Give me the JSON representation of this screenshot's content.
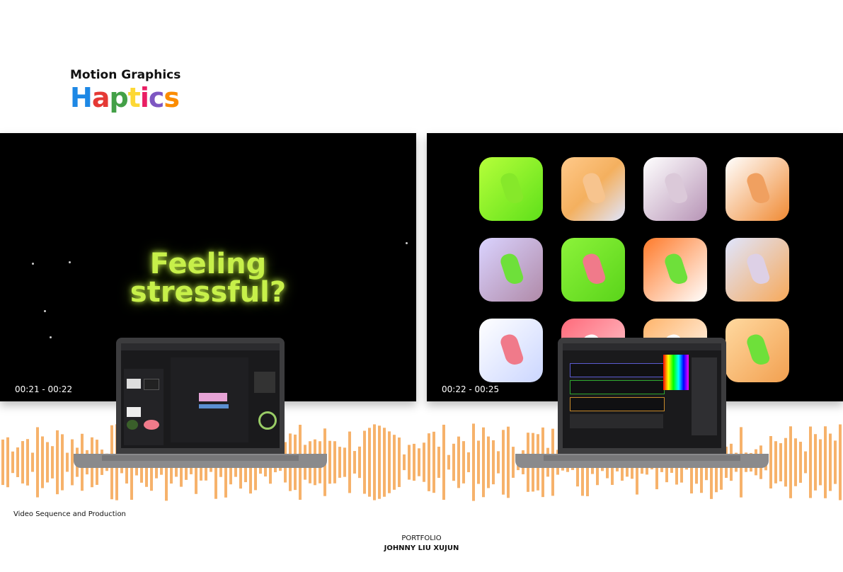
{
  "header": {
    "title": "Motion Graphics",
    "logo": [
      "H",
      "a",
      "p",
      "t",
      "i",
      "c",
      "s"
    ],
    "logo_colors": [
      "#1e88e5",
      "#e53935",
      "#43a047",
      "#fdd835",
      "#e91e63",
      "#7e57c2",
      "#fb8c00"
    ]
  },
  "left_panel": {
    "headline_line1": "Feeling",
    "headline_line2": "stressful?",
    "timestamp": "00:21 - 00:22"
  },
  "right_panel": {
    "timestamp": "00:22 - 00:25",
    "tiles": [
      {
        "bg": "linear-gradient(135deg,#b6ff3a,#5fe01a)",
        "blob": "#86e82a"
      },
      {
        "bg": "linear-gradient(135deg,#ffc98a,#f4b05f,#dfe6ff)",
        "blob": "#f7c48e"
      },
      {
        "bg": "linear-gradient(135deg,#ffffff,#b794b6)",
        "blob": "#dbc9d9"
      },
      {
        "bg": "linear-gradient(135deg,#ffffff,#f08a33)",
        "blob": "#f0a060"
      },
      {
        "bg": "linear-gradient(135deg,#dad3ff,#b08aa8)",
        "blob": "#6ee03a"
      },
      {
        "bg": "linear-gradient(135deg,#8cf33a,#5ad41a)",
        "blob": "#f07a8a"
      },
      {
        "bg": "linear-gradient(135deg,#ff7a2a,#ffffff)",
        "blob": "#6ee03a"
      },
      {
        "bg": "linear-gradient(135deg,#dfe6ff,#f7a95a)",
        "blob": "#ddd0e6"
      },
      {
        "bg": "linear-gradient(135deg,#ffffff,#cbd6ff)",
        "blob": "#f07a8a"
      },
      {
        "bg": "linear-gradient(135deg,#ff6a7a,#ffd0d6)",
        "blob": "#ffffff"
      },
      {
        "bg": "linear-gradient(135deg,#ffb46a,#ffffff)",
        "blob": "#ffffff"
      },
      {
        "bg": "linear-gradient(135deg,#ffd9a0,#f2a050)",
        "blob": "#6ee03a"
      }
    ]
  },
  "waveform_color": "#f6b26b",
  "footer": {
    "caption": "Video Sequence and Production",
    "portfolio": "PORTFOLIO",
    "author": "JOHNNY LIU XUJUN"
  }
}
